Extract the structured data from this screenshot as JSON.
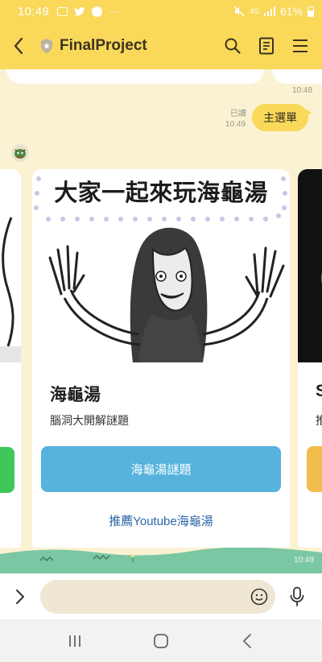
{
  "status_bar": {
    "time": "10:49",
    "extra": "···",
    "network": "4G",
    "battery": "61%"
  },
  "header": {
    "title": "FinalProject"
  },
  "chat": {
    "prev_timestamp": "10:48",
    "read_label": "已讀",
    "my_message": {
      "text": "主選單",
      "time": "10:49"
    },
    "ground_timestamp": "10:49"
  },
  "card": {
    "banner_title": "大家一起來玩海龜湯",
    "title": "海龜湯",
    "subtitle": "腦洞大開解謎題",
    "primary_button": "海龜湯謎題",
    "link_button": "推薦Youtube海龜湯"
  },
  "next_card": {
    "title_initial": "S",
    "subtitle_initial": "推"
  },
  "input": {
    "placeholder": "",
    "value": ""
  },
  "colors": {
    "header": "#f9d85a",
    "background": "#fbf2d3",
    "primary_button": "#55b3dc",
    "link": "#2a66a8",
    "ground": "#7cc7a3"
  }
}
